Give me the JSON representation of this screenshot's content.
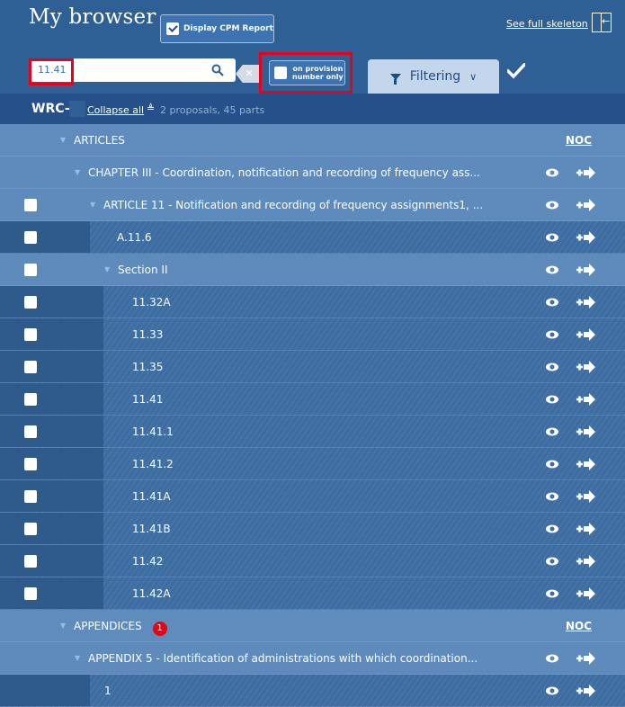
{
  "header": {
    "title": "My browser",
    "cpm_report_label": "Display CPM Report",
    "cpm_checked": true,
    "skeleton_link": "See full skeleton"
  },
  "search": {
    "value": "11.41",
    "on_provision_label_line1": "on provision",
    "on_provision_label_line2": "number only",
    "filtering_label": "Filtering"
  },
  "wrc": {
    "label": "WRC-",
    "collapse_label": "Collapse all",
    "summary": "2 proposals, 45 parts"
  },
  "tree": {
    "articles": {
      "label": "ARTICLES",
      "noc": "NOC"
    },
    "chapter": {
      "label": "CHAPTER III - Coordination, notification and recording of frequency ass..."
    },
    "article": {
      "label": "ARTICLE 11 - Notification and recording of frequency assignments1, ..."
    },
    "a116": {
      "label": "A.11.6"
    },
    "section": {
      "label": "Section II"
    },
    "provisions": [
      "11.32A",
      "11.33",
      "11.35",
      "11.41",
      "11.41.1",
      "11.41.2",
      "11.41A",
      "11.41B",
      "11.42",
      "11.42A"
    ],
    "appendices": {
      "label": "APPENDICES",
      "badge": "1",
      "noc": "NOC"
    },
    "appendix5": {
      "label": "APPENDIX 5 - Identification of administrations with which coordination..."
    },
    "appendix_item": {
      "label": "1"
    }
  },
  "colors": {
    "header_bg": "#2e5f95",
    "highlight_red": "#e8001c",
    "badge_red": "#e30613",
    "filter_tab_bg": "#c3d6ec"
  }
}
